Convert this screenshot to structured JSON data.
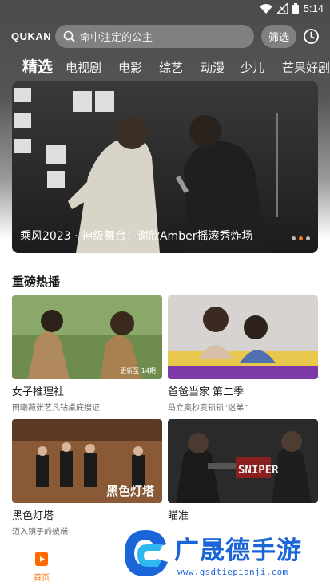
{
  "status_bar": {
    "time": "5:14"
  },
  "header": {
    "logo": "QUKAN",
    "search_placeholder": "命中注定的公主",
    "filter_label": "筛选"
  },
  "tabs": [
    {
      "label": "精选",
      "active": true
    },
    {
      "label": "电视剧",
      "active": false
    },
    {
      "label": "电影",
      "active": false
    },
    {
      "label": "综艺",
      "active": false
    },
    {
      "label": "动漫",
      "active": false
    },
    {
      "label": "少儿",
      "active": false
    },
    {
      "label": "芒果好剧",
      "active": false
    }
  ],
  "banner": {
    "caption": "乘风2023 · 神级舞台！谢欣Amber摇滚秀炸场",
    "dots": 3,
    "active_dot": 1
  },
  "section": {
    "title": "重磅热播",
    "cards": [
      {
        "title": "女子推理社",
        "subtitle": "田曦薇张艺凡钻桌底搜证",
        "badge": "更新至 14期"
      },
      {
        "title": "爸爸当家 第二季",
        "subtitle": "马立奥秒变锁锁“迷弟”",
        "badge": ""
      },
      {
        "title": "黑色灯塔",
        "subtitle": "迈入镜子的彼端",
        "badge": "",
        "poster_text": "黑色灯塔"
      },
      {
        "title": "瞄准",
        "subtitle": "",
        "badge": "",
        "poster_text": "SNIPER"
      }
    ]
  },
  "bottom_nav": {
    "home_label": "首页"
  },
  "watermark": {
    "brand": "广晟德手游",
    "url": "www.gsdtiepianji.com"
  },
  "colors": {
    "accent": "#ff6a00",
    "watermark_blue": "#1a66d9"
  }
}
